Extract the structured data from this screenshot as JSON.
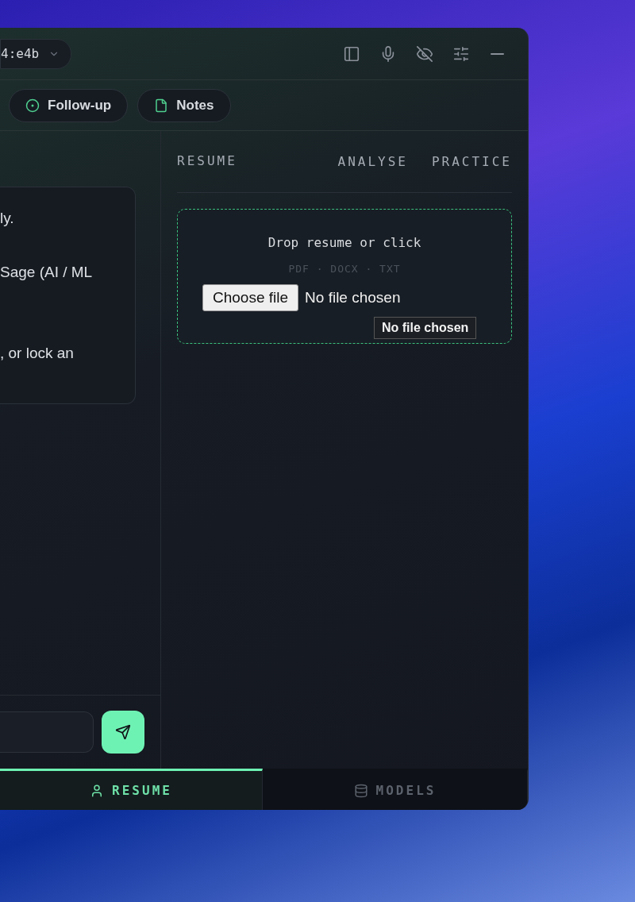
{
  "session": {
    "label": "4:e4b"
  },
  "chips": [
    {
      "kind": "followup",
      "label": "Follow-up"
    },
    {
      "kind": "notes",
      "label": "Notes"
    }
  ],
  "chat": {
    "lines": [
      "ly.",
      "Sage (AI / ML",
      ", or lock an"
    ]
  },
  "panel": {
    "title": "RESUME",
    "actions": [
      "ANALYSE",
      "PRACTICE"
    ],
    "dropzone": {
      "title": "Drop resume or click",
      "formats": "PDF · DOCX · TXT",
      "choose_button": "Choose file",
      "file_status": "No file chosen",
      "tooltip": "No file chosen"
    }
  },
  "bottom_tabs": [
    {
      "kind": "resume",
      "label": "RESUME",
      "selected": true
    },
    {
      "kind": "models",
      "label": "MODELS",
      "selected": false
    }
  ]
}
